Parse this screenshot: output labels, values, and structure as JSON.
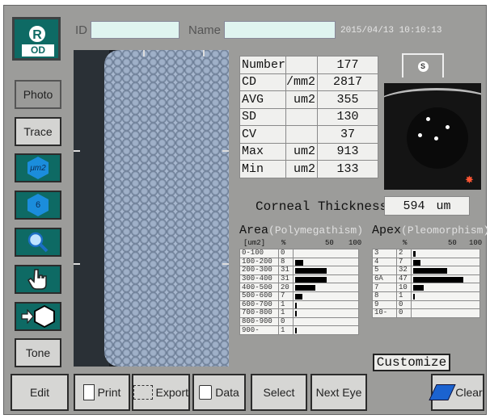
{
  "header": {
    "eye_side": "R",
    "eye_code": "OD",
    "id_label": "ID",
    "name_label": "Name",
    "datetime": "2015/04/13 10:10:13"
  },
  "left_menu": {
    "photo": "Photo",
    "trace": "Trace",
    "area_unit_label": "μm2",
    "six_label": "6",
    "tone": "Tone"
  },
  "stats": [
    {
      "key": "Number",
      "unit": "",
      "value": "177"
    },
    {
      "key": "CD",
      "unit": "/mm2",
      "value": "2817"
    },
    {
      "key": "AVG",
      "unit": "um2",
      "value": "355"
    },
    {
      "key": "SD",
      "unit": "",
      "value": "130"
    },
    {
      "key": "CV",
      "unit": "",
      "value": "37"
    },
    {
      "key": "Max",
      "unit": "um2",
      "value": "913"
    },
    {
      "key": "Min",
      "unit": "um2",
      "value": "133"
    }
  ],
  "tab_icon": "S",
  "thickness": {
    "label": "Corneal Thickness",
    "value": "594",
    "unit": "um"
  },
  "area_hist": {
    "title": "Area",
    "subtitle": "(Polymegathism)",
    "scale_unit": "[um2]",
    "scale_pct": "%",
    "scale_50": "50",
    "scale_100": "100",
    "rows": [
      {
        "range": "0-100",
        "pct": "0",
        "val": 0
      },
      {
        "range": "100-200",
        "pct": "8",
        "val": 8
      },
      {
        "range": "200-300",
        "pct": "31",
        "val": 31
      },
      {
        "range": "300-400",
        "pct": "31",
        "val": 31
      },
      {
        "range": "400-500",
        "pct": "20",
        "val": 20
      },
      {
        "range": "500-600",
        "pct": "7",
        "val": 7
      },
      {
        "range": "600-700",
        "pct": "1",
        "val": 1
      },
      {
        "range": "700-800",
        "pct": "1",
        "val": 1
      },
      {
        "range": "800-900",
        "pct": "0",
        "val": 0
      },
      {
        "range": "900-",
        "pct": "1",
        "val": 1
      }
    ]
  },
  "apex_hist": {
    "title": "Apex",
    "subtitle": "(Pleomorphism)",
    "scale_pct": "%",
    "scale_50": "50",
    "scale_100": "100",
    "rows": [
      {
        "range": "3",
        "pct": "2",
        "val": 2
      },
      {
        "range": "4",
        "pct": "7",
        "val": 7
      },
      {
        "range": "5",
        "pct": "32",
        "val": 32
      },
      {
        "range": "6A",
        "pct": "47",
        "val": 47
      },
      {
        "range": "7",
        "pct": "10",
        "val": 10
      },
      {
        "range": "8",
        "pct": "1",
        "val": 1
      },
      {
        "range": "9",
        "pct": "0",
        "val": 0
      },
      {
        "range": "10-",
        "pct": "0",
        "val": 0
      }
    ]
  },
  "customize_label": "Customize",
  "bottom_bar": {
    "edit": "Edit",
    "print": "Print",
    "export": "Export",
    "data": "Data",
    "select": "Select",
    "next_eye": "Next Eye",
    "clear": "Clear"
  }
}
